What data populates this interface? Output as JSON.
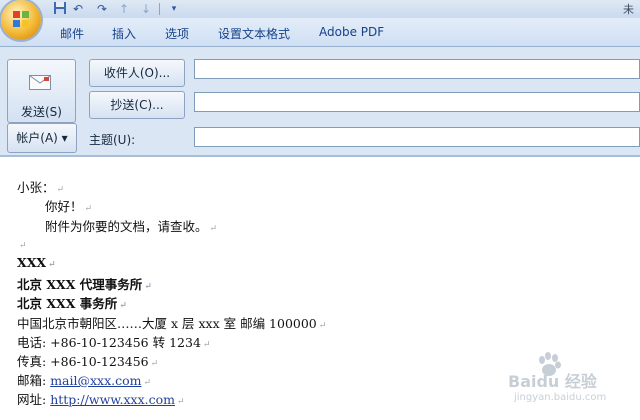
{
  "window": {
    "title_partial": "未"
  },
  "quick_access": [
    "save-icon",
    "undo-icon",
    "redo-icon",
    "up-arrow-icon",
    "down-arrow-icon",
    "customize-icon"
  ],
  "ribbon": {
    "tabs": [
      "邮件",
      "插入",
      "选项",
      "设置文本格式",
      "Adobe PDF"
    ]
  },
  "header": {
    "send_label": "发送(S)",
    "to_label": "收件人(O)...",
    "cc_label": "抄送(C)...",
    "account_label": "帐户(A) ▾",
    "subject_label": "主题(U):",
    "to_value": "",
    "cc_value": "",
    "subject_value": ""
  },
  "body": {
    "lines": [
      "小张：",
      "你好！",
      "附件为你要的文档，请查收。",
      "",
      "XXX",
      "北京 XXX 代理事务所",
      "北京 XXX 事务所",
      "中国北京市朝阳区……大厦 x 层 xxx 室  邮编 100000",
      "电话: +86-10-123456  转  1234",
      "传真: +86-10-123456",
      "邮箱: ",
      "网址: "
    ],
    "email_link": "mail@xxx.com",
    "web_link": "http://www.xxx.com",
    "para_mark": "↵"
  },
  "watermark": {
    "brand": "Baidu 经验",
    "sub": "jingyan.baidu.com"
  },
  "colors": {
    "ribbon": "#cfdff3",
    "header": "#dbe6f4",
    "link": "#1f3f9c",
    "office_orb": "#f2b632"
  }
}
